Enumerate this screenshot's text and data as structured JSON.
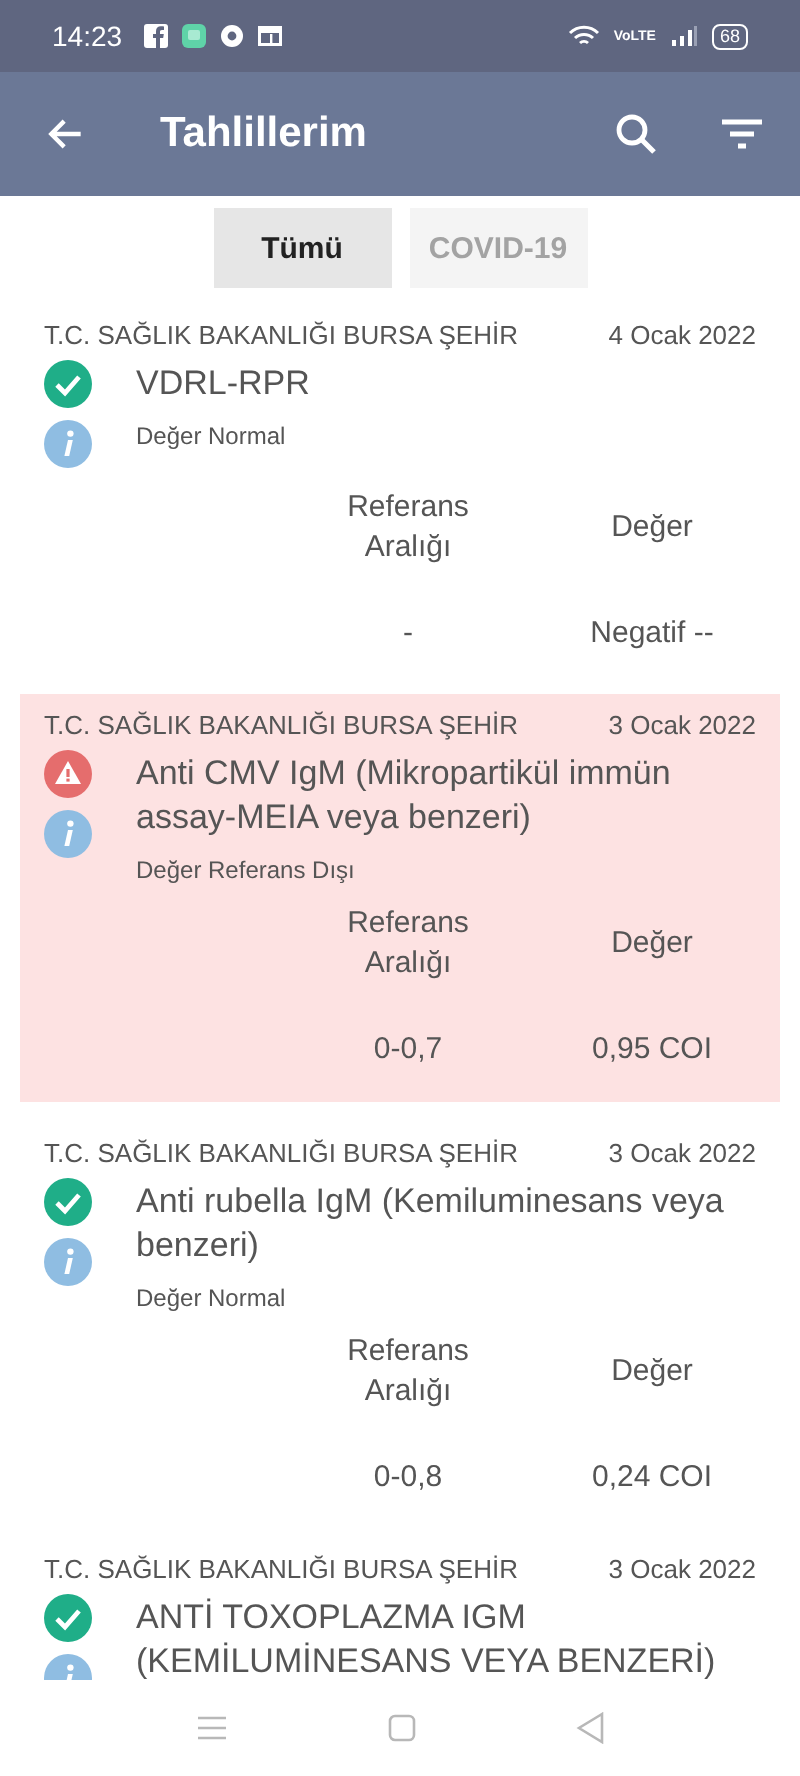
{
  "status_bar": {
    "time": "14:23",
    "network": "VoLTE",
    "battery": "68"
  },
  "app_bar": {
    "title": "Tahlillerim"
  },
  "tabs": [
    {
      "label": "Tümü",
      "selected": true
    },
    {
      "label": "COVID-19",
      "selected": false
    }
  ],
  "results": [
    {
      "institution": "T.C. SAĞLIK BAKANLIĞI BURSA ŞEHİR",
      "date": "4 Ocak 2022",
      "test": "VDRL-RPR",
      "kind": "normal",
      "status": "Değer Normal",
      "columns": [
        "Referans Aralığı",
        "Değer"
      ],
      "reference": "-",
      "value": "Negatif --"
    },
    {
      "institution": "T.C. SAĞLIK BAKANLIĞI BURSA ŞEHİR",
      "date": "3 Ocak 2022",
      "test": "Anti CMV IgM (Mikropartikül immün assay-MEIA veya benzeri)",
      "kind": "abnormal",
      "status": "Değer Referans Dışı",
      "columns": [
        "Referans Aralığı",
        "Değer"
      ],
      "reference": "0-0,7",
      "value": "0,95 COI"
    },
    {
      "institution": "T.C. SAĞLIK BAKANLIĞI BURSA ŞEHİR",
      "date": "3 Ocak 2022",
      "test": "Anti rubella IgM (Kemiluminesans veya benzeri)",
      "kind": "normal",
      "status": "Değer Normal",
      "columns": [
        "Referans Aralığı",
        "Değer"
      ],
      "reference": "0-0,8",
      "value": "0,24 COI"
    },
    {
      "institution": "T.C. SAĞLIK BAKANLIĞI BURSA ŞEHİR",
      "date": "3 Ocak 2022",
      "test": "ANTİ TOXOPLAZMA IGM (KEMİLUMİNESANS VEYA BENZERİ)",
      "kind": "normal"
    }
  ]
}
